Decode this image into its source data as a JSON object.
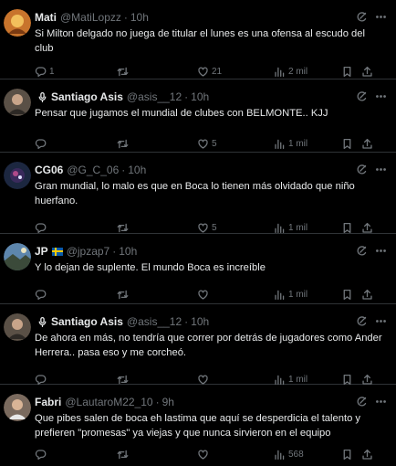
{
  "tweets": [
    {
      "name": "Mati",
      "handle": "@MatiLopzz",
      "time": "10h",
      "text": "Si Milton delgado no juega de titular el lunes es una ofensa al escudo del club",
      "replies": "1",
      "retweets": "",
      "likes": "21",
      "views": "2 mil",
      "avatar_color": "#c8742c"
    },
    {
      "name": "Santiago Asis",
      "handle": "@asis__12",
      "time": "10h",
      "text": "Pensar que jugamos el mundial de clubes con BELMONTE.. KJJ",
      "replies": "",
      "retweets": "",
      "likes": "5",
      "views": "1 mil",
      "avatar_color": "#5a5046"
    },
    {
      "name": "CG06",
      "handle": "@G_C_06",
      "time": "10h",
      "text": "Gran mundial, lo malo es que en Boca lo tienen más olvidado que niño huerfano.",
      "replies": "",
      "retweets": "",
      "likes": "5",
      "views": "1 mil",
      "avatar_color": "#1c2740"
    },
    {
      "name": "JP",
      "handle": "@jpzap7",
      "time": "10h",
      "text": "Y lo dejan de suplente. El mundo Boca es increíble",
      "replies": "",
      "retweets": "",
      "likes": "",
      "views": "1 mil",
      "avatar_color": "#5d86ad"
    },
    {
      "name": "Santiago Asis",
      "handle": "@asis__12",
      "time": "10h",
      "text": "De ahora en más, no tendría que correr por detrás de jugadores como Ander Herrera.. pasa eso y me corcheó.",
      "replies": "",
      "retweets": "",
      "likes": "",
      "views": "1 mil",
      "avatar_color": "#5a5046"
    },
    {
      "name": "Fabri",
      "handle": "@LautaroM22_10",
      "time": "9h",
      "text": "Que pibes salen de boca eh lastima que aquí se desperdicia el talento y prefieren \"promesas\" ya viejas y que nunca sirvieron en el equipo",
      "replies": "",
      "retweets": "",
      "likes": "",
      "views": "568",
      "avatar_color": "#7a6a5e"
    }
  ],
  "icons": {
    "reply": "reply-icon",
    "retweet": "retweet-icon",
    "like": "like-icon",
    "views": "views-icon",
    "bookmark": "bookmark-icon",
    "share": "share-icon",
    "grok": "grok-icon",
    "more": "more-icon",
    "mic": "microphone-icon",
    "flag": "sweden-flag-icon"
  },
  "colors": {
    "background": "#000000",
    "text": "#e7e9ea",
    "muted": "#71767b",
    "divider": "#2f3336"
  }
}
